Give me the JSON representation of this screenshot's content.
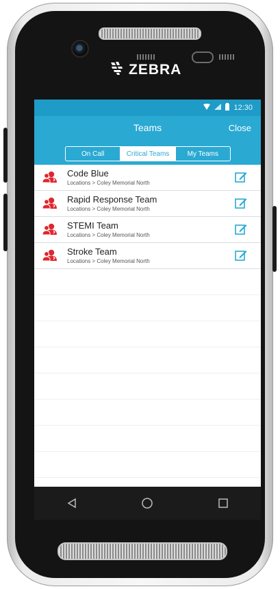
{
  "device": {
    "brand": "ZEBRA"
  },
  "status_bar": {
    "time": "12:30",
    "icons": [
      "wifi-icon",
      "signal-icon",
      "battery-icon"
    ]
  },
  "header": {
    "title": "Teams",
    "close_label": "Close"
  },
  "tabs": [
    {
      "label": "On Call",
      "active": false
    },
    {
      "label": "Critical Teams",
      "active": true
    },
    {
      "label": "My Teams",
      "active": false
    }
  ],
  "teams": [
    {
      "name": "Code Blue",
      "location": "Locations > Coley Memorial North"
    },
    {
      "name": "Rapid Response Team",
      "location": "Locations > Coley Memorial North"
    },
    {
      "name": "STEMI Team",
      "location": "Locations > Coley Memorial North"
    },
    {
      "name": "Stroke Team",
      "location": "Locations > Coley Memorial North"
    }
  ],
  "nav_bar": {
    "icons": [
      "back-icon",
      "home-icon",
      "recents-icon"
    ]
  },
  "colors": {
    "accent": "#2aa9d3",
    "status_bar": "#1e9cc7",
    "team_icon": "#e0262e",
    "edit_icon": "#2aa9d3"
  }
}
